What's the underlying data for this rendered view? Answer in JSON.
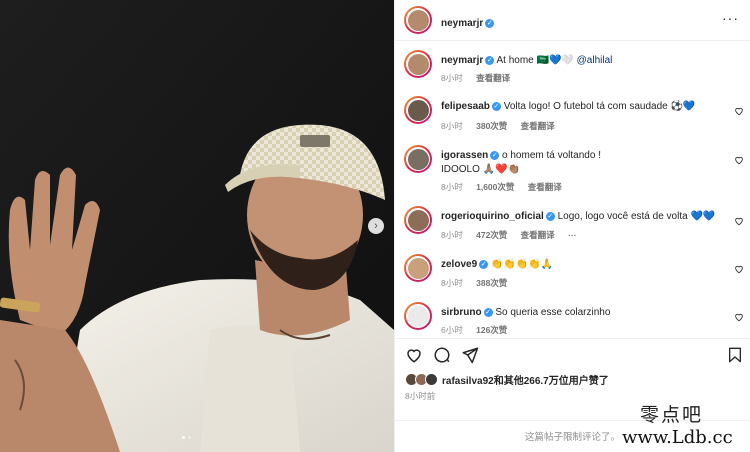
{
  "header": {
    "username": "neymarjr"
  },
  "caption": {
    "username": "neymarjr",
    "text": "At home 🇸🇦💙🤍",
    "mention": "@alhilal",
    "time": "8小时",
    "translate": "查看翻译"
  },
  "comments": [
    {
      "username": "felipesaab",
      "text": "Volta logo! O futebol tá com saudade ⚽💙",
      "time": "8小时",
      "likes": "380次赞",
      "translate": "查看翻译"
    },
    {
      "username": "igorassen",
      "text": "o homem tá voltando !",
      "text2": "IDOOLO 🙏🏽❤️👏🏽",
      "time": "8小时",
      "likes": "1,600次赞",
      "translate": "查看翻译"
    },
    {
      "username": "rogerioquirino_oficial",
      "text": "Logo, logo você está de volta 💙💙",
      "time": "8小时",
      "likes": "472次赞",
      "translate": "查看翻译",
      "more": "···"
    },
    {
      "username": "zelove9",
      "text": "👏👏👏👏🙏",
      "time": "8小时",
      "likes": "388次赞"
    },
    {
      "username": "sirbruno",
      "text": "So queria esse colarzinho",
      "time": "6小时",
      "likes": "126次赞"
    }
  ],
  "likes_text": "rafasilva92和其他266.7万位用户赞了",
  "post_time": "8小时前",
  "limited_text": "这篇帖子限制评论了。",
  "icons": {
    "verified": "verified-badge-icon",
    "like": "heart-icon",
    "comment": "comment-icon",
    "share": "share-icon",
    "save": "bookmark-icon",
    "more": "more-options-icon",
    "next": "chevron-right-icon"
  },
  "colors": {
    "verified": "#3897f0",
    "link": "#00376b",
    "secondary_text": "#8e8e8e"
  },
  "watermark": {
    "line1": "零点吧",
    "line2": "www.Ldb.cc"
  }
}
